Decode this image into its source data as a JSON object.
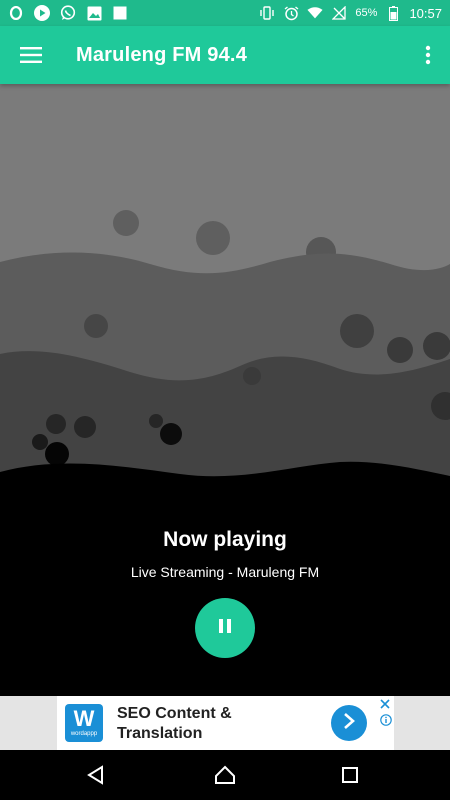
{
  "statusbar": {
    "notification_icons": [
      "opera-icon",
      "play-icon",
      "whatsapp-icon",
      "image-icon",
      "square-icon"
    ],
    "system_icons": [
      "vibrate-icon",
      "alarm-icon",
      "wifi-icon",
      "no-signal-icon"
    ],
    "battery": "65%",
    "time": "10:57"
  },
  "appbar": {
    "title": "Maruleng FM 94.4",
    "menu_icon": "hamburger-menu-icon",
    "more_icon": "more-vert-icon"
  },
  "player": {
    "heading": "Now playing",
    "subtitle": "Live Streaming - Maruleng FM",
    "state": "playing",
    "button_icon": "pause-icon"
  },
  "ad": {
    "logo_letter": "W",
    "logo_caption": "wordappp",
    "headline": "SEO Content & Translation",
    "cta_icon": "chevron-right-icon"
  },
  "navbar": {
    "items": [
      "back-icon",
      "home-icon",
      "recents-icon"
    ]
  },
  "colors": {
    "accent": "#1fc99a",
    "statusbar": "#1fba8c",
    "ad_blue": "#1a8fd6"
  }
}
